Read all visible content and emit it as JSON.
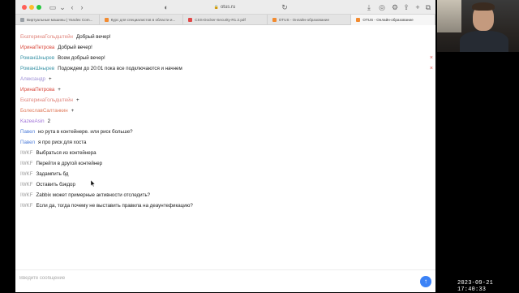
{
  "browser": {
    "url": "otus.ru",
    "tabs": [
      {
        "label": "Виртуальные машины | Yandex Com...",
        "favicon": "yandex-cloud",
        "active": false
      },
      {
        "label": "Курс для специалистов в области и...",
        "favicon": "otus",
        "active": false
      },
      {
        "label": "CSS-Docker-Security-R1.2.pdf",
        "favicon": "pdf",
        "active": false
      },
      {
        "label": "OTUS - Онлайн-образование",
        "favicon": "otus",
        "active": false
      },
      {
        "label": "OTUS - Онлайн-образование",
        "favicon": "otus",
        "active": true
      }
    ]
  },
  "chat": {
    "messages": [
      {
        "author": "ЕкатеринаГольдштейн",
        "text": "Добрый вечер!",
        "deletable": false
      },
      {
        "author": "ИринаПетрова",
        "text": "Добрый вечер!",
        "deletable": false
      },
      {
        "author": "РоманШнырев",
        "text": "Всем добрый вечер!",
        "deletable": true
      },
      {
        "author": "РоманШнырев",
        "text": "Подождем до 20:01 пока все подключаются и начнем",
        "deletable": true
      },
      {
        "author": "Александр",
        "text": "+",
        "deletable": false
      },
      {
        "author": "ИринаПетрова",
        "text": "+",
        "deletable": false
      },
      {
        "author": "ЕкатеринаГольдштейн",
        "text": "+",
        "deletable": false
      },
      {
        "author": "БолеславСалтанкин",
        "text": "+",
        "deletable": false
      },
      {
        "author": "KazeeAsin",
        "text": "2",
        "deletable": false
      },
      {
        "author": "Павел",
        "text": "но рута в контейнере. или риск больше?",
        "deletable": false
      },
      {
        "author": "Павел",
        "text": "я про риск для хоста",
        "deletable": false
      },
      {
        "author": "IWKF",
        "text": "Выбраться из контейнера",
        "deletable": false
      },
      {
        "author": "IWKF",
        "text": "Перейти в другой контейнер",
        "deletable": false
      },
      {
        "author": "IWKF",
        "text": "Задампить бд",
        "deletable": false
      },
      {
        "author": "IWKF",
        "text": "Оставить бэкдор",
        "deletable": false
      },
      {
        "author": "IWKF",
        "text": "Zabbix может примерные активности отследить?",
        "deletable": false
      },
      {
        "author": "IWKF",
        "text": "Если да, тогда почему не выставить правила на деаунтефикацию?",
        "deletable": false
      }
    ],
    "delete_glyph": "×"
  },
  "composer": {
    "placeholder": "Введите сообщение",
    "value": "",
    "send_icon": "arrow-up-icon"
  },
  "overlay": {
    "timestamp": "2023-09-21 17:40:33"
  }
}
